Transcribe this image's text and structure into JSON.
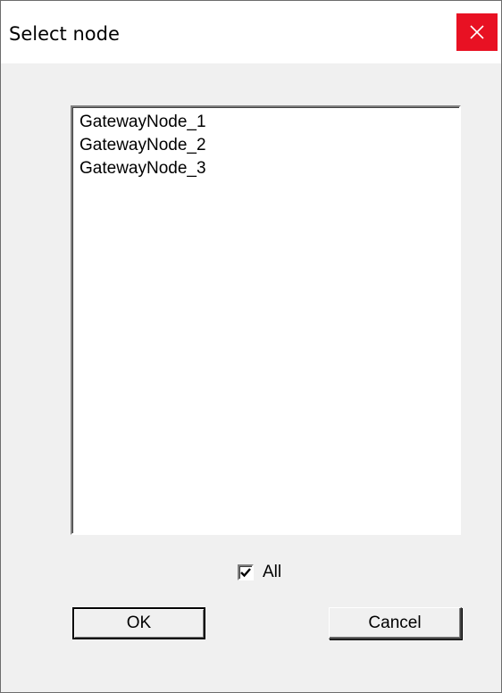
{
  "window": {
    "title": "Select node",
    "close_icon": "close-icon",
    "close_color": "#e81123"
  },
  "list": {
    "items": [
      {
        "label": "GatewayNode_1"
      },
      {
        "label": "GatewayNode_2"
      },
      {
        "label": "GatewayNode_3"
      }
    ]
  },
  "all_checkbox": {
    "label": "All",
    "checked": true
  },
  "buttons": {
    "ok_label": "OK",
    "cancel_label": "Cancel"
  }
}
